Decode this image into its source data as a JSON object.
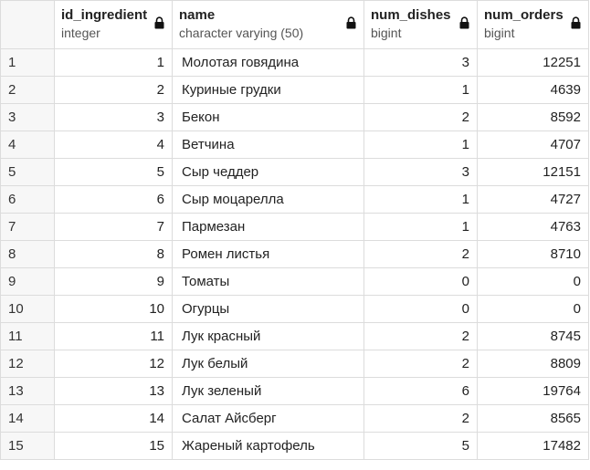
{
  "columns": [
    {
      "name": "id_ingredient",
      "type": "integer",
      "locked": true
    },
    {
      "name": "name",
      "type": "character varying (50)",
      "locked": true
    },
    {
      "name": "num_dishes",
      "type": "bigint",
      "locked": true
    },
    {
      "name": "num_orders",
      "type": "bigint",
      "locked": true
    }
  ],
  "rows": [
    {
      "row": "1",
      "id_ingredient": "1",
      "name": "Молотая говядина",
      "num_dishes": "3",
      "num_orders": "12251"
    },
    {
      "row": "2",
      "id_ingredient": "2",
      "name": "Куриные грудки",
      "num_dishes": "1",
      "num_orders": "4639"
    },
    {
      "row": "3",
      "id_ingredient": "3",
      "name": "Бекон",
      "num_dishes": "2",
      "num_orders": "8592"
    },
    {
      "row": "4",
      "id_ingredient": "4",
      "name": "Ветчина",
      "num_dishes": "1",
      "num_orders": "4707"
    },
    {
      "row": "5",
      "id_ingredient": "5",
      "name": "Сыр чеддер",
      "num_dishes": "3",
      "num_orders": "12151"
    },
    {
      "row": "6",
      "id_ingredient": "6",
      "name": "Сыр моцарелла",
      "num_dishes": "1",
      "num_orders": "4727"
    },
    {
      "row": "7",
      "id_ingredient": "7",
      "name": "Пармезан",
      "num_dishes": "1",
      "num_orders": "4763"
    },
    {
      "row": "8",
      "id_ingredient": "8",
      "name": "Ромен листья",
      "num_dishes": "2",
      "num_orders": "8710"
    },
    {
      "row": "9",
      "id_ingredient": "9",
      "name": "Томаты",
      "num_dishes": "0",
      "num_orders": "0"
    },
    {
      "row": "10",
      "id_ingredient": "10",
      "name": "Огурцы",
      "num_dishes": "0",
      "num_orders": "0"
    },
    {
      "row": "11",
      "id_ingredient": "11",
      "name": "Лук красный",
      "num_dishes": "2",
      "num_orders": "8745"
    },
    {
      "row": "12",
      "id_ingredient": "12",
      "name": "Лук белый",
      "num_dishes": "2",
      "num_orders": "8809"
    },
    {
      "row": "13",
      "id_ingredient": "13",
      "name": "Лук зеленый",
      "num_dishes": "6",
      "num_orders": "19764"
    },
    {
      "row": "14",
      "id_ingredient": "14",
      "name": "Салат Айсберг",
      "num_dishes": "2",
      "num_orders": "8565"
    },
    {
      "row": "15",
      "id_ingredient": "15",
      "name": "Жареный картофель",
      "num_dishes": "5",
      "num_orders": "17482"
    }
  ],
  "icons": {
    "lock": "lock-icon"
  },
  "colors": {
    "header_bg": "#ffffff",
    "rownum_bg": "#f7f7f7",
    "border": "#dcdcdc",
    "text": "#222222",
    "type_text": "#555555"
  }
}
